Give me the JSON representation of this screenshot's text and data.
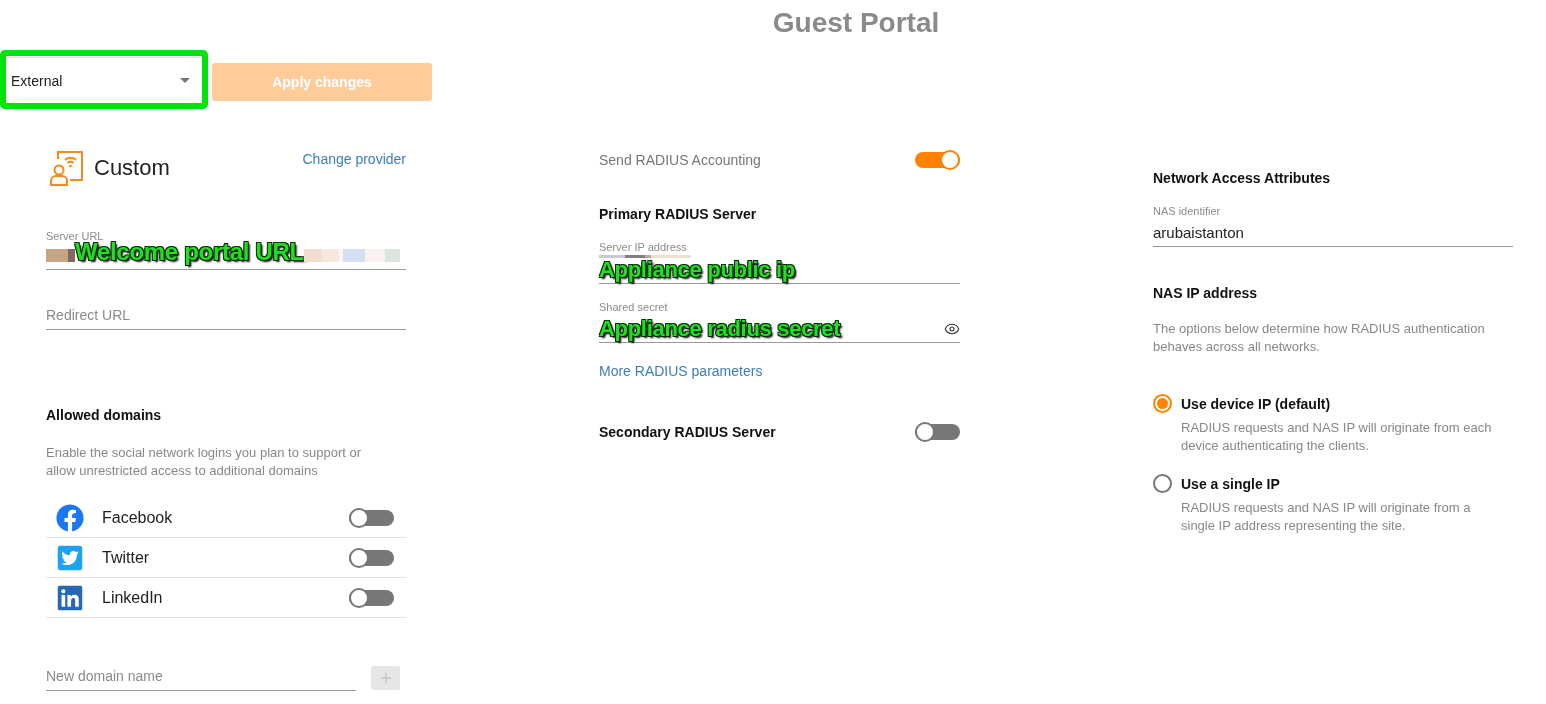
{
  "page": {
    "title": "Guest Portal"
  },
  "toolbar": {
    "mode_select": {
      "value": "External",
      "highlighted": true
    },
    "apply_button": {
      "label": "Apply changes",
      "disabled": true
    }
  },
  "portal": {
    "provider": "Custom",
    "change_link": "Change provider",
    "server_url": {
      "label": "Server URL",
      "redacted": true,
      "annotation": "Welcome portal URL"
    },
    "redirect_url": {
      "placeholder": "Redirect URL"
    }
  },
  "allowed_domains": {
    "title": "Allowed domains",
    "description": "Enable the social network logins you plan to support or allow unrestricted access to additional domains",
    "items": [
      {
        "kind": "facebook",
        "label": "Facebook",
        "on": false
      },
      {
        "kind": "twitter",
        "label": "Twitter",
        "on": false
      },
      {
        "kind": "linkedin",
        "label": "LinkedIn",
        "on": false
      }
    ],
    "new_domain": {
      "placeholder": "New domain name",
      "add_disabled": true
    }
  },
  "radius": {
    "accounting": {
      "label": "Send RADIUS Accounting",
      "on": true
    },
    "primary": {
      "title": "Primary RADIUS Server",
      "server_ip": {
        "label": "Server IP address",
        "redacted": true,
        "annotation": "Appliance public ip"
      },
      "shared_secret": {
        "label": "Shared secret",
        "annotation": "Appliance radius secret"
      }
    },
    "more_link": "More RADIUS parameters",
    "secondary": {
      "title": "Secondary RADIUS Server",
      "on": false
    }
  },
  "network_access": {
    "title": "Network Access Attributes",
    "nas_identifier": {
      "label": "NAS identifier",
      "value": "arubaistanton"
    },
    "nas_ip": {
      "title": "NAS IP address",
      "description": "The options below determine how RADIUS authentication behaves across all networks.",
      "options": [
        {
          "label": "Use device IP (default)",
          "description": "RADIUS requests and NAS IP will originate from each device authenticating the clients.",
          "selected": true
        },
        {
          "label": "Use a single IP",
          "description": "RADIUS requests and NAS IP will originate from a single IP address representing the site.",
          "selected": false
        }
      ]
    }
  }
}
